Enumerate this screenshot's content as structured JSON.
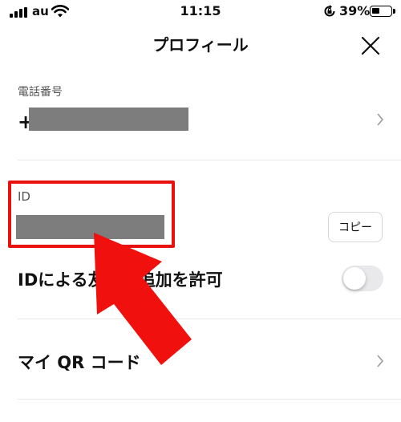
{
  "status_bar": {
    "carrier": "au",
    "time": "11:15",
    "battery_percent": "39%",
    "battery_level": 0.39,
    "icons": [
      "signal-icon",
      "wifi-icon",
      "orientation-lock-icon",
      "battery-icon"
    ]
  },
  "header": {
    "title": "プロフィール",
    "close_icon": "close-icon"
  },
  "phone": {
    "label": "電話番号",
    "prefix": "+"
  },
  "id_section": {
    "label": "ID",
    "copy_label": "コピー"
  },
  "allow_friend": {
    "label": "IDによる友だち追加を許可",
    "enabled": false
  },
  "qr": {
    "label": "マイ QR コード"
  },
  "annotation": {
    "highlight_color": "#e8110f",
    "arrow_color": "#f0100d"
  }
}
